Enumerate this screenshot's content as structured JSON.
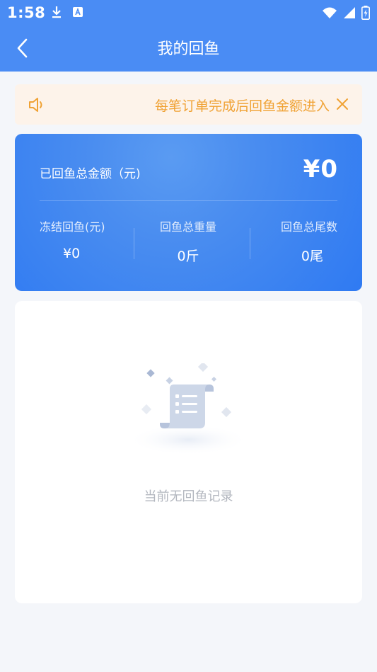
{
  "status_bar": {
    "time": "1:58"
  },
  "nav": {
    "title": "我的回鱼"
  },
  "notice": {
    "text": "每笔订单完成后回鱼金额进入"
  },
  "summary": {
    "total_label": "已回鱼总金额（元)",
    "total_amount": "¥0",
    "stats": [
      {
        "label": "冻结回鱼(元)",
        "value": "¥0"
      },
      {
        "label": "回鱼总重量",
        "value": "0斤"
      },
      {
        "label": "回鱼总尾数",
        "value": "0尾"
      }
    ]
  },
  "records": {
    "empty_text": "当前无回鱼记录"
  },
  "colors": {
    "primary": "#4a8cf4",
    "notice_bg": "#fdf3ea",
    "notice_text": "#f0a234",
    "background": "#f4f6fa"
  }
}
